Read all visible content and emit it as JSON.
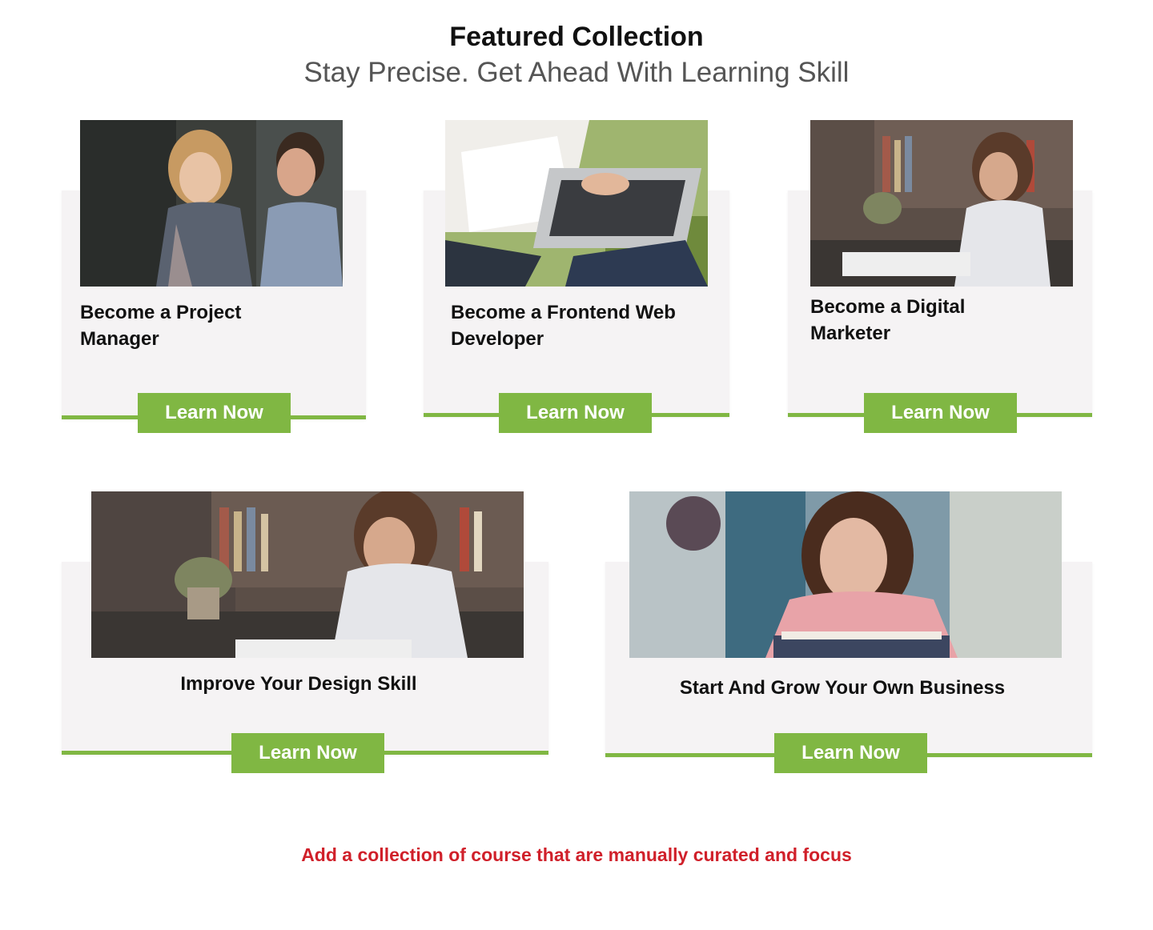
{
  "header": {
    "title": "Featured Collection",
    "subtitle": "Stay Precise. Get Ahead With Learning  Skill"
  },
  "cards": [
    {
      "title": "Become a Project Manager",
      "button_label": "Learn Now",
      "image_icon": "photo-two-students-talking"
    },
    {
      "title": "Become a Frontend Web Developer",
      "button_label": "Learn Now",
      "image_icon": "photo-laptop-and-notebook"
    },
    {
      "title": "Become a Digital Marketer",
      "button_label": "Learn Now",
      "image_icon": "photo-woman-writing-in-library"
    },
    {
      "title": "Improve Your Design Skill",
      "button_label": "Learn Now",
      "image_icon": "photo-woman-writing-in-library"
    },
    {
      "title": "Start And Grow Your Own Business",
      "button_label": "Learn Now",
      "image_icon": "photo-smiling-woman-on-books"
    }
  ],
  "footer_note": "Add a collection of course that are manually curated and focus",
  "colors": {
    "accent": "#80b743",
    "card_bg": "#f5f3f4",
    "note": "#d0202a",
    "subtitle": "#555555"
  }
}
